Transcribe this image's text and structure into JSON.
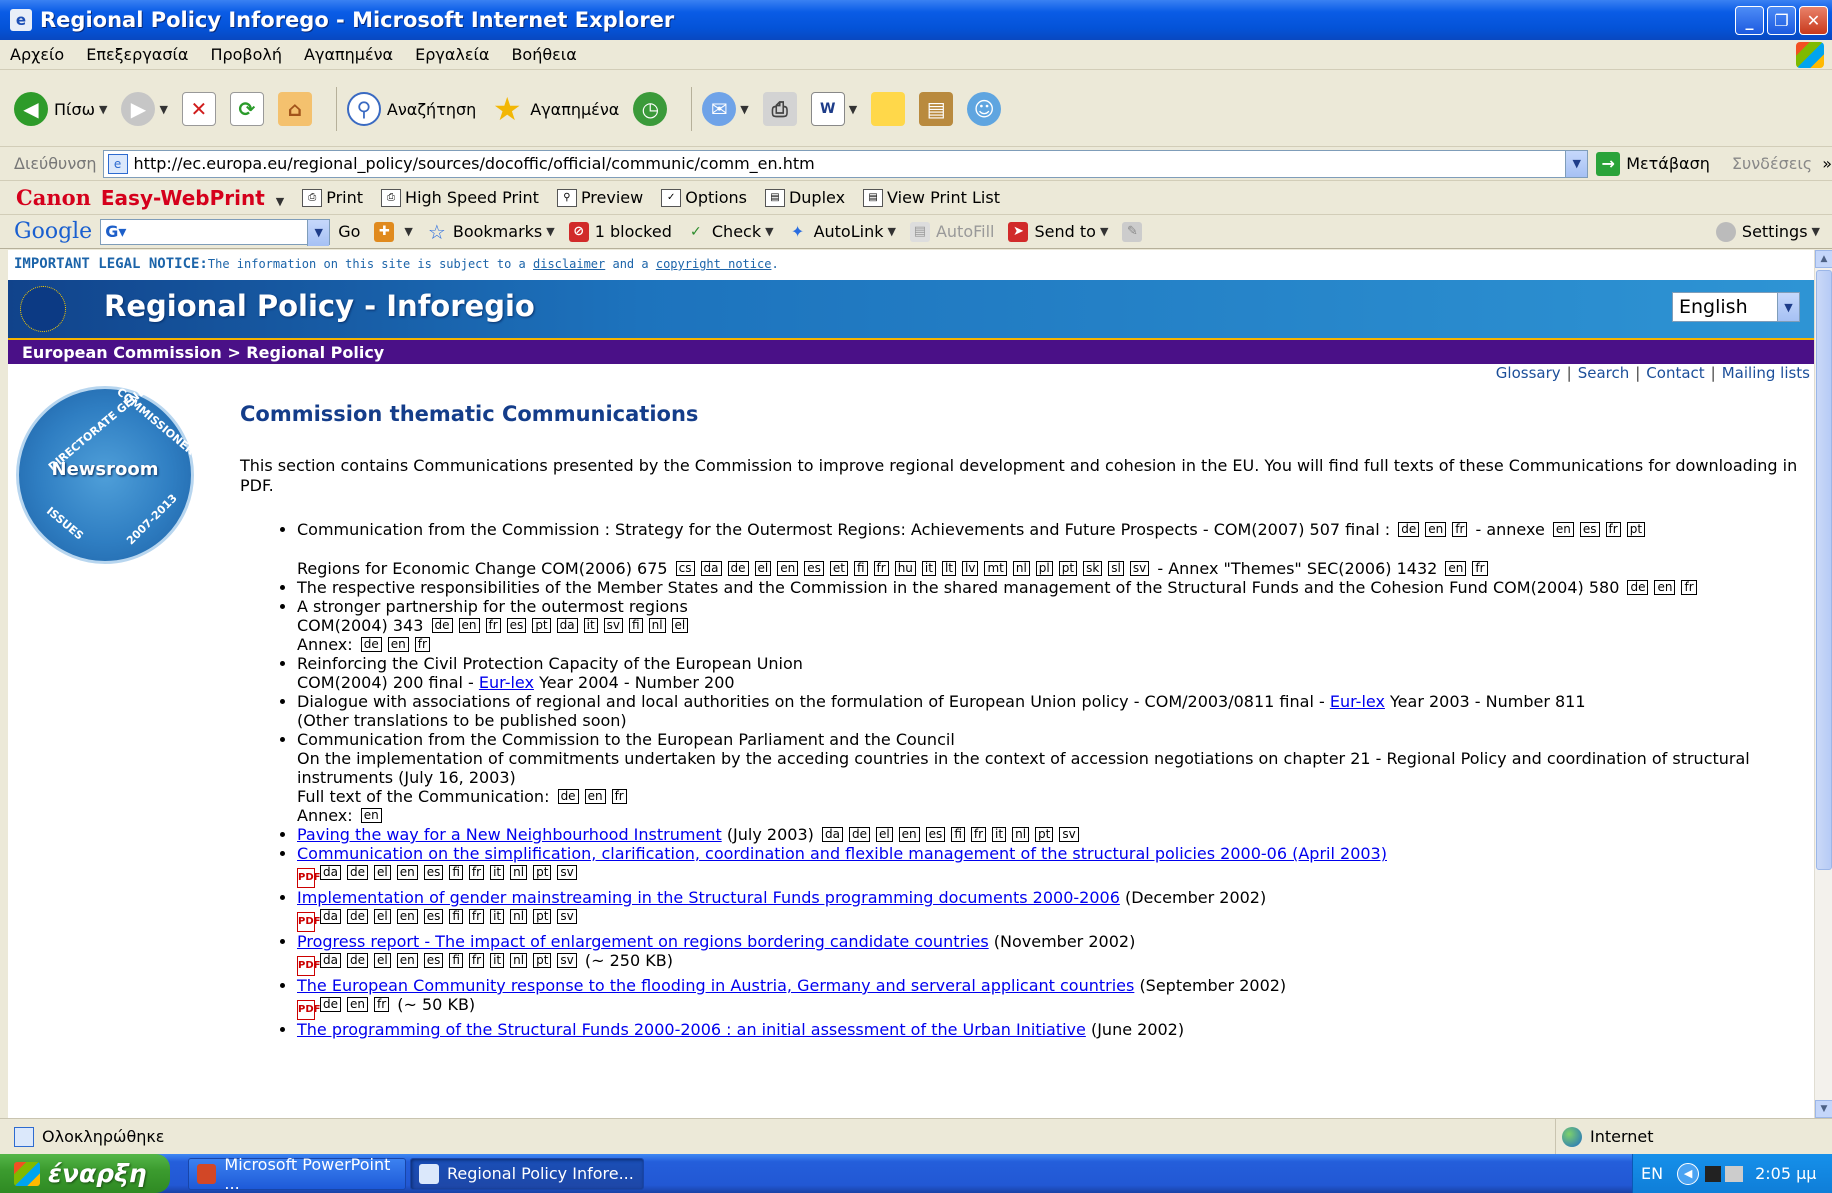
{
  "window": {
    "title": "Regional Policy Inforego - Microsoft Internet Explorer"
  },
  "menu": [
    "Αρχείο",
    "Επεξεργασία",
    "Προβολή",
    "Αγαπημένα",
    "Εργαλεία",
    "Βοήθεια"
  ],
  "toolbar": {
    "back": "Πίσω",
    "search": "Αναζήτηση",
    "favorites": "Αγαπημένα"
  },
  "address": {
    "label": "Διεύθυνση",
    "url": "http://ec.europa.eu/regional_policy/sources/docoffic/official/communic/comm_en.htm",
    "go": "Μετάβαση",
    "links": "Συνδέσεις",
    "more": "»"
  },
  "canon": {
    "brand": "Canon",
    "product": "Easy-WebPrint",
    "print": "Print",
    "high_speed": "High Speed Print",
    "preview": "Preview",
    "options": "Options",
    "duplex": "Duplex",
    "view_print_list": "View Print List"
  },
  "google": {
    "logo": "Google",
    "go": "Go",
    "bookmarks": "Bookmarks",
    "blocked": "1 blocked",
    "check": "Check",
    "autolink": "AutoLink",
    "autofill": "AutoFill",
    "send_to": "Send to",
    "settings": "Settings"
  },
  "page": {
    "notice_label": "IMPORTANT LEGAL NOTICE:",
    "notice_text": "The information on this site is subject to a",
    "notice_disclaimer": "disclaimer",
    "notice_and": "and a",
    "notice_copyright": "copyright notice",
    "notice_end": ".",
    "banner_title": "Regional Policy - Inforegio",
    "language": "English",
    "breadcrumb": "European Commission > Regional Policy",
    "toplinks": [
      "Glossary",
      "Search",
      "Contact",
      "Mailing lists"
    ],
    "badge": {
      "center": "Newsroom",
      "top_left": "DIRECTORATE GENERAL",
      "top_right": "COMMISSIONER",
      "bottom_left": "ISSUES",
      "bottom_right": "2007-2013"
    },
    "heading": "Commission thematic Communications",
    "intro": "This section contains Communications presented by the Commission to improve regional development and cohesion in the EU. You will find full texts of these Communications for downloading in PDF."
  },
  "items": [
    {
      "text": "Communication from the Commission : Strategy for the Outermost Regions: Achievements and Future Prospects - COM(2007) 507 final :",
      "langs": [
        "de",
        "en",
        "fr"
      ],
      "annex_label": "- annexe",
      "annex_langs": [
        "en",
        "es",
        "fr",
        "pt"
      ]
    },
    {
      "text": "Regions for Economic Change COM(2006) 675",
      "langs": [
        "cs",
        "da",
        "de",
        "el",
        "en",
        "es",
        "et",
        "fi",
        "fr",
        "hu",
        "it",
        "lt",
        "lv",
        "mt",
        "nl",
        "pl",
        "pt",
        "sk",
        "sl",
        "sv"
      ],
      "annex_label": "- Annex \"Themes\" SEC(2006) 1432",
      "annex_langs": [
        "en",
        "fr"
      ]
    },
    {
      "text": "The respective responsibilities of the Member States and the Commission in the shared management of the Structural Funds and the Cohesion Fund COM(2004) 580",
      "langs": [
        "de",
        "en",
        "fr"
      ]
    },
    {
      "text": "A stronger partnership for the outermost regions",
      "line2": "COM(2004) 343",
      "langs": [
        "de",
        "en",
        "fr",
        "es",
        "pt",
        "da",
        "it",
        "sv",
        "fi",
        "nl",
        "el"
      ],
      "annex_label": "Annex:",
      "annex_langs": [
        "de",
        "en",
        "fr"
      ]
    },
    {
      "text": "Reinforcing the Civil Protection Capacity of the European Union",
      "line2": "COM(2004) 200 final -",
      "link": "Eur-lex",
      "after": "Year 2004 - Number 200"
    },
    {
      "text": "Dialogue with associations of regional and local authorities on the formulation of European Union policy - COM/2003/0811 final -",
      "link": "Eur-lex",
      "after": "Year 2003 - Number 811",
      "line2": "(Other translations to be published soon)"
    },
    {
      "text": "Communication from the Commission to the European Parliament and the Council",
      "line2": "On the implementation of commitments undertaken by the acceding countries in the context of accession negotiations on chapter 21 - Regional Policy and coordination of structural instruments (July 16, 2003)",
      "full_label": "Full text of the Communication:",
      "langs": [
        "de",
        "en",
        "fr"
      ],
      "annex_label": "Annex:",
      "annex_langs": [
        "en"
      ]
    },
    {
      "link": "Paving the way for a New Neighbourhood Instrument",
      "after": "(July 2003)",
      "langs": [
        "da",
        "de",
        "el",
        "en",
        "es",
        "fi",
        "fr",
        "it",
        "nl",
        "pt",
        "sv"
      ]
    },
    {
      "link": "Communication on the simplification, clarification, coordination and flexible management of the structural policies 2000-06 (April 2003)",
      "langs": [
        "da",
        "de",
        "el",
        "en",
        "es",
        "fi",
        "fr",
        "it",
        "nl",
        "pt",
        "sv"
      ]
    },
    {
      "link": "Implementation of gender mainstreaming in the Structural Funds programming documents 2000-2006",
      "after": "(December 2002)",
      "langs": [
        "da",
        "de",
        "el",
        "en",
        "es",
        "fi",
        "fr",
        "it",
        "nl",
        "pt",
        "sv"
      ]
    },
    {
      "link": "Progress report - The impact of enlargement on regions bordering candidate countries",
      "after": "(November 2002)",
      "langs": [
        "da",
        "de",
        "el",
        "en",
        "es",
        "fi",
        "fr",
        "it",
        "nl",
        "pt",
        "sv"
      ],
      "size": "(~ 250 KB)"
    },
    {
      "link": "The European Community response to the flooding in Austria, Germany and serveral applicant countries",
      "after": "(September 2002)",
      "langs": [
        "de",
        "en",
        "fr"
      ],
      "size": "(~ 50 KB)"
    },
    {
      "link": "The programming of the Structural Funds 2000-2006 : an initial assessment of the Urban Initiative",
      "after": "(June 2002)"
    }
  ],
  "status": {
    "text": "Ολοκληρώθηκε",
    "zone": "Internet"
  },
  "taskbar": {
    "start": "έναρξη",
    "tasks": [
      "Microsoft PowerPoint ...",
      "Regional Policy Infore..."
    ],
    "lang": "EN",
    "clock": "2:05 μμ"
  },
  "colors": {
    "accent": "#0453d8",
    "banner": "#1d73bd",
    "breadcrumb_bg": "#4a1087",
    "heading": "#143d8a",
    "link": "#0000ee"
  }
}
